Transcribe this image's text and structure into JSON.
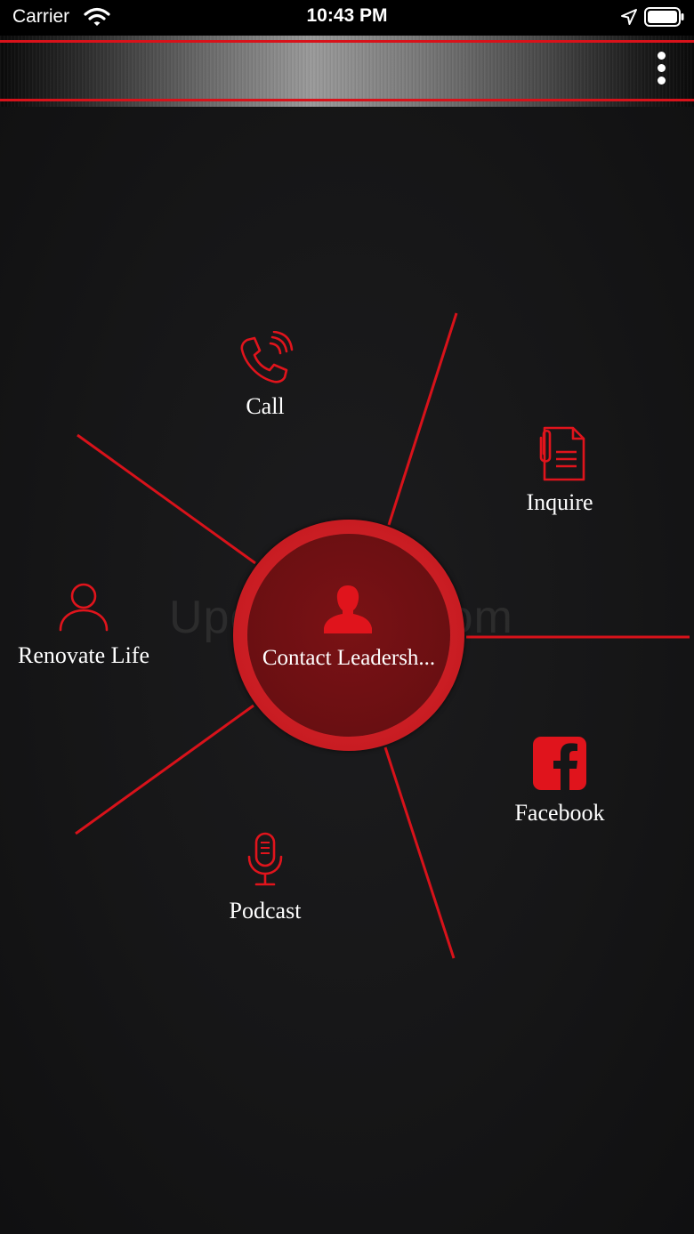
{
  "status_bar": {
    "carrier": "Carrier",
    "time": "10:43 PM"
  },
  "header": {
    "menu_icon": "more-vertical-icon"
  },
  "watermark": "UpdateStar.com",
  "center": {
    "label": "Contact Leadersh...",
    "icon": "person-silhouette-icon"
  },
  "menu_items": [
    {
      "label": "Call",
      "icon": "phone-ringing-icon"
    },
    {
      "label": "Inquire",
      "icon": "document-clip-icon"
    },
    {
      "label": "Renovate Life",
      "icon": "user-icon"
    },
    {
      "label": "Facebook",
      "icon": "facebook-icon"
    },
    {
      "label": "Podcast",
      "icon": "microphone-icon"
    }
  ],
  "colors": {
    "accent": "#d8121a",
    "background": "#161617",
    "text": "#ffffff"
  }
}
